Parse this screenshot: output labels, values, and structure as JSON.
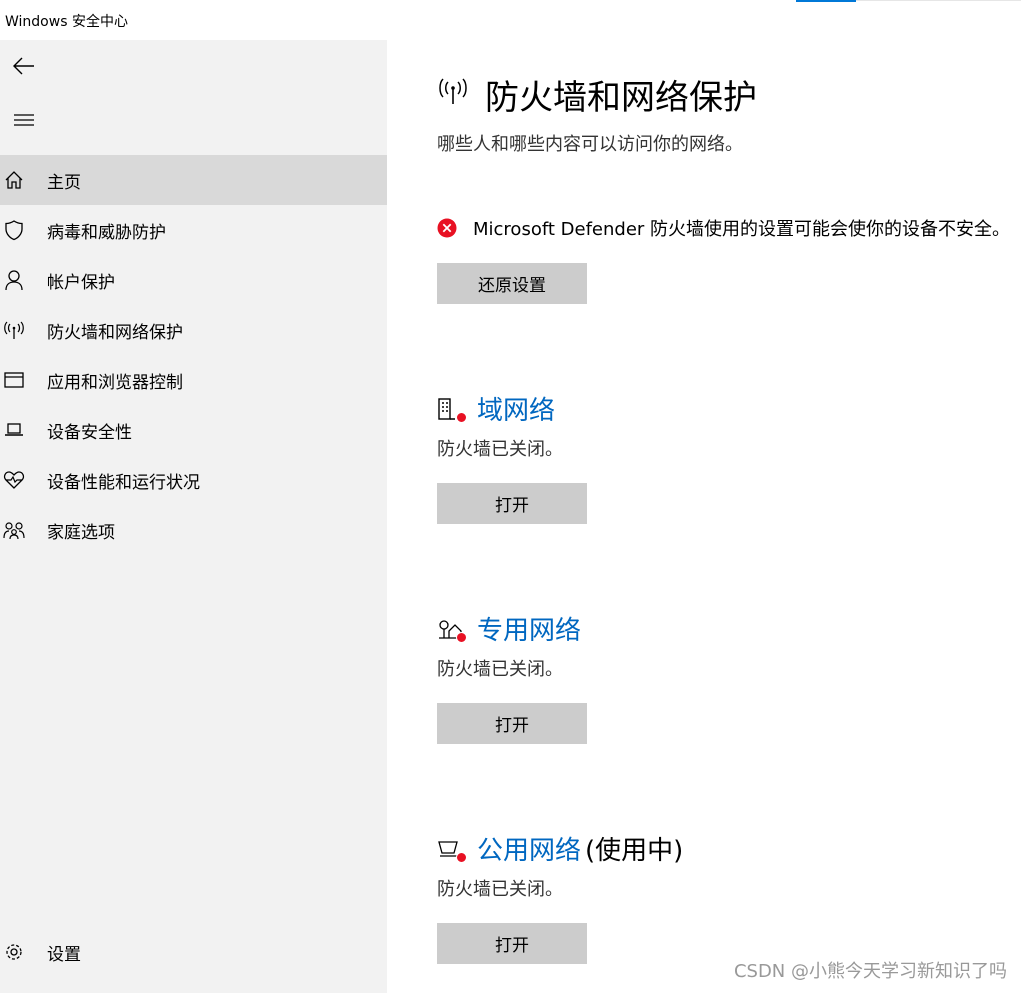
{
  "window": {
    "title": "Windows 安全中心"
  },
  "sidebar": {
    "back_icon": "back-arrow-icon",
    "menu_icon": "hamburger-icon",
    "items": [
      {
        "label": "主页",
        "icon": "home-icon",
        "active": true
      },
      {
        "label": "病毒和威胁防护",
        "icon": "shield-icon",
        "active": false
      },
      {
        "label": "帐户保护",
        "icon": "person-icon",
        "active": false
      },
      {
        "label": "防火墙和网络保护",
        "icon": "wifi-antenna-icon",
        "active": false
      },
      {
        "label": "应用和浏览器控制",
        "icon": "app-window-icon",
        "active": false
      },
      {
        "label": "设备安全性",
        "icon": "laptop-icon",
        "active": false
      },
      {
        "label": "设备性能和运行状况",
        "icon": "heart-pulse-icon",
        "active": false
      },
      {
        "label": "家庭选项",
        "icon": "family-icon",
        "active": false
      }
    ],
    "settings_label": "设置"
  },
  "main": {
    "title": "防火墙和网络保护",
    "subtitle": "哪些人和哪些内容可以访问你的网络。",
    "warning": {
      "text": "Microsoft Defender 防火墙使用的设置可能会使你的设备不安全。",
      "restore_button": "还原设置"
    },
    "networks": [
      {
        "name": "域网络",
        "extra": "",
        "status": "防火墙已关闭。",
        "button": "打开",
        "icon": "domain-network-icon"
      },
      {
        "name": "专用网络",
        "extra": "",
        "status": "防火墙已关闭。",
        "button": "打开",
        "icon": "private-network-icon"
      },
      {
        "name": "公用网络",
        "extra": "(使用中)",
        "status": "防火墙已关闭。",
        "button": "打开",
        "icon": "public-network-icon"
      }
    ]
  },
  "watermark": "CSDN @小熊今天学习新知识了吗",
  "colors": {
    "accent": "#0078d7",
    "link": "#0067c0",
    "error": "#e81123",
    "sidebar_bg": "#f2f2f2",
    "button_bg": "#cccccc"
  }
}
